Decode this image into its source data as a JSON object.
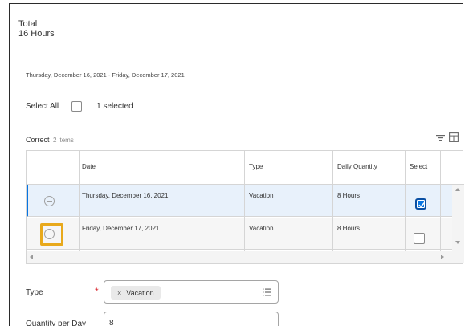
{
  "summary": {
    "total_label": "Total",
    "total_value": "16 Hours",
    "date_range": "Thursday, December 16, 2021 - Friday, December 17, 2021"
  },
  "selection": {
    "select_all_label": "Select All",
    "select_all_checked": false,
    "selected_count": "1 selected"
  },
  "grid": {
    "title": "Correct",
    "item_count": "2 items",
    "icons": [
      "filter-icon",
      "table-view-icon"
    ],
    "columns": [
      "Date",
      "Type",
      "Daily Quantity",
      "Select"
    ],
    "rows": [
      {
        "date": "Thursday, December 16, 2021",
        "type": "Vacation",
        "daily_quantity": "8 Hours",
        "selected": true
      },
      {
        "date": "Friday, December 17, 2021",
        "type": "Vacation",
        "daily_quantity": "8 Hours",
        "selected": false
      }
    ]
  },
  "form": {
    "type_label": "Type",
    "required_marker": "*",
    "type_pill_remove": "×",
    "type_value": "Vacation",
    "quantity_label": "Quantity per Day",
    "quantity_value": "8"
  },
  "colors": {
    "accent": "#0875e1",
    "highlight": "#e8a91c",
    "required": "#d9262e",
    "selected_row": "#e8f1fb"
  }
}
